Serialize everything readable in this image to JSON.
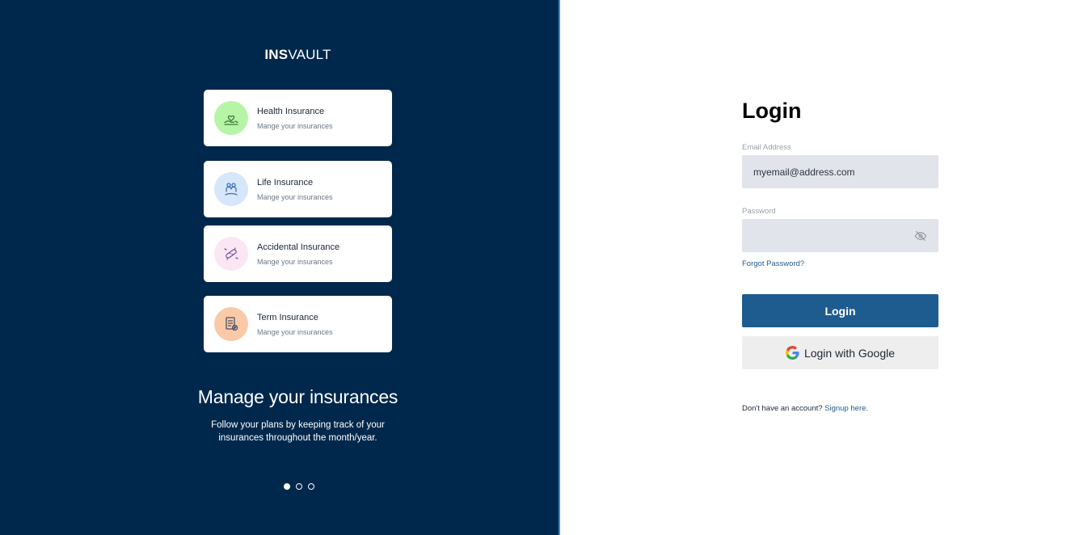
{
  "brand": {
    "bold": "INS",
    "light": "VAULT"
  },
  "cards": [
    {
      "title": "Health Insurance",
      "subtitle": "Mange your insurances",
      "icon": "health-hand-heart-icon",
      "bg": "#b6f5a6",
      "icon_color": "#3b7a3b"
    },
    {
      "title": "Life Insurance",
      "subtitle": "Mange your insurances",
      "icon": "life-family-icon",
      "bg": "#d6e6fb",
      "icon_color": "#3f6db0"
    },
    {
      "title": "Accidental Insurance",
      "subtitle": "Mange your insurances",
      "icon": "accident-bandage-icon",
      "bg": "#fbe6f3",
      "icon_color": "#6f5aa6"
    },
    {
      "title": "Term Insurance",
      "subtitle": "Mange your insurances",
      "icon": "term-document-icon",
      "bg": "#f9c9a8",
      "icon_color": "#4a4f66"
    }
  ],
  "promo": {
    "headline": "Manage your insurances",
    "description": "Follow your plans by keeping track of your insurances throughout the month/year."
  },
  "carousel": {
    "total": 3,
    "active_index": 0
  },
  "login": {
    "title": "Login",
    "email_label": "Email Address",
    "email_value": "myemail@address.com",
    "password_label": "Password",
    "password_value": "",
    "forgot_label": "Forgot Password?",
    "login_button": "Login",
    "google_button": "Login with Google",
    "signup_prompt": "Don't have an account?",
    "signup_link": "Signup here."
  },
  "colors": {
    "panel_bg": "#00284c",
    "accent": "#1e5c8f",
    "divider": "#3a8fd6",
    "input_bg": "#e2e4ec"
  }
}
